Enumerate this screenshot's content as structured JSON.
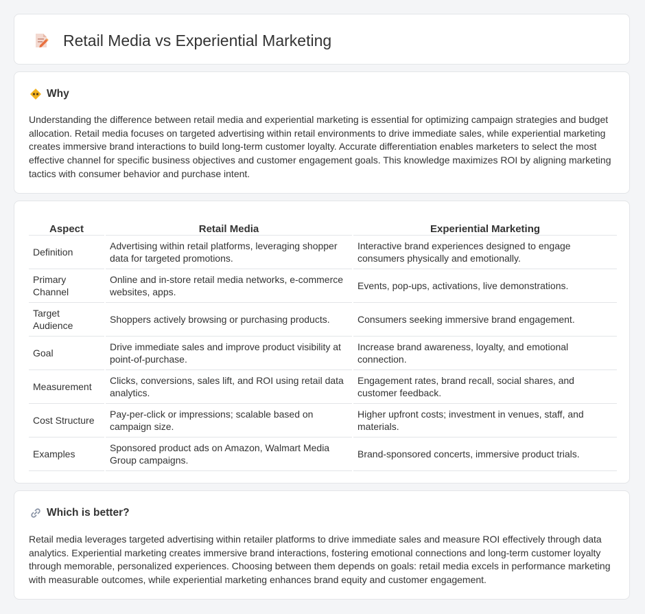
{
  "header": {
    "title": "Retail Media vs Experiential Marketing",
    "icon": "document-pencil-icon"
  },
  "why": {
    "heading": "Why",
    "icon": "diamond-warning-icon",
    "text": "Understanding the difference between retail media and experiential marketing is essential for optimizing campaign strategies and budget allocation. Retail media focuses on targeted advertising within retail environments to drive immediate sales, while experiential marketing creates immersive brand interactions to build long-term customer loyalty. Accurate differentiation enables marketers to select the most effective channel for specific business objectives and customer engagement goals. This knowledge maximizes ROI by aligning marketing tactics with consumer behavior and purchase intent."
  },
  "table": {
    "headers": [
      "Aspect",
      "Retail Media",
      "Experiential Marketing"
    ],
    "rows": [
      [
        "Definition",
        "Advertising within retail platforms, leveraging shopper data for targeted promotions.",
        "Interactive brand experiences designed to engage consumers physically and emotionally."
      ],
      [
        "Primary Channel",
        "Online and in-store retail media networks, e-commerce websites, apps.",
        "Events, pop-ups, activations, live demonstrations."
      ],
      [
        "Target Audience",
        "Shoppers actively browsing or purchasing products.",
        "Consumers seeking immersive brand engagement."
      ],
      [
        "Goal",
        "Drive immediate sales and improve product visibility at point-of-purchase.",
        "Increase brand awareness, loyalty, and emotional connection."
      ],
      [
        "Measurement",
        "Clicks, conversions, sales lift, and ROI using retail data analytics.",
        "Engagement rates, brand recall, social shares, and customer feedback."
      ],
      [
        "Cost Structure",
        "Pay-per-click or impressions; scalable based on campaign size.",
        "Higher upfront costs; investment in venues, staff, and materials."
      ],
      [
        "Examples",
        "Sponsored product ads on Amazon, Walmart Media Group campaigns.",
        "Brand-sponsored concerts, immersive product trials."
      ]
    ]
  },
  "better": {
    "heading": "Which is better?",
    "icon": "link-icon",
    "text": "Retail media leverages targeted advertising within retailer platforms to drive immediate sales and measure ROI effectively through data analytics. Experiential marketing creates immersive brand interactions, fostering emotional connections and long-term customer loyalty through memorable, personalized experiences. Choosing between them depends on goals: retail media excels in performance marketing with measurable outcomes, while experiential marketing enhances brand equity and customer engagement."
  }
}
